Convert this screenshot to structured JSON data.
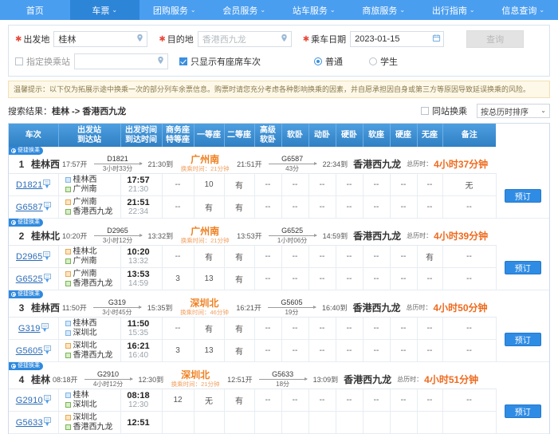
{
  "nav": {
    "items": [
      {
        "label": "首页",
        "caret": false,
        "active": false
      },
      {
        "label": "车票",
        "caret": true,
        "active": true
      },
      {
        "label": "团购服务",
        "caret": true,
        "active": false
      },
      {
        "label": "会员服务",
        "caret": true,
        "active": false
      },
      {
        "label": "站车服务",
        "caret": true,
        "active": false
      },
      {
        "label": "商旅服务",
        "caret": true,
        "active": false
      },
      {
        "label": "出行指南",
        "caret": true,
        "active": false
      },
      {
        "label": "信息查询",
        "caret": true,
        "active": false
      }
    ],
    "caret_glyph": "⌄"
  },
  "form": {
    "origin_label": "出发地",
    "origin_value": "桂林",
    "dest_label": "目的地",
    "dest_placeholder": "香港西九龙",
    "date_label": "乘车日期",
    "date_value": "2023-01-15",
    "search_label": "查询",
    "transfer_station_label": "指定换乘站",
    "transfer_station_value": "",
    "only_available_label": "只显示有座席车次",
    "only_available_checked": true,
    "ticket_type_normal": "普通",
    "ticket_type_student": "学生",
    "ticket_type_selected": "普通",
    "location_icon": "location-pin-icon",
    "calendar_icon": "calendar-icon"
  },
  "notice": {
    "text": "温馨提示：以下仅为拓展示途中换乘一次的部分列车余票信息。购票时请您充分考虑各种影响换乘的因素，并自愿承担因自身或第三方等原因导致延误换乘的风险。"
  },
  "results_bar": {
    "label": "搜索结果：",
    "route": "桂林 -> 香港西九龙",
    "same_station_label": "同站换乘",
    "same_station_checked": false,
    "sort_value": "按总历时排序",
    "sort_caret": "⌄"
  },
  "table": {
    "headers": [
      {
        "l1": "车次",
        "l2": ""
      },
      {
        "l1": "出发站",
        "l2": "到达站"
      },
      {
        "l1": "出发时间",
        "l2": "到达时间"
      },
      {
        "l1": "商务座",
        "l2": "特等座"
      },
      {
        "l1": "一等座",
        "l2": ""
      },
      {
        "l1": "二等座",
        "l2": ""
      },
      {
        "l1": "高级",
        "l2": "软卧"
      },
      {
        "l1": "软卧",
        "l2": ""
      },
      {
        "l1": "动卧",
        "l2": ""
      },
      {
        "l1": "硬卧",
        "l2": ""
      },
      {
        "l1": "软座",
        "l2": ""
      },
      {
        "l1": "硬座",
        "l2": ""
      },
      {
        "l1": "无座",
        "l2": ""
      },
      {
        "l1": "备注",
        "l2": ""
      }
    ],
    "tag_label": "便捷换乘",
    "book_label": "预订",
    "total_label": "总历时：",
    "transfer_time_prefix": "换乘时间："
  },
  "results": [
    {
      "index": "1",
      "from": "桂林西",
      "dep": "17:57开",
      "leg1_train": "D1821",
      "leg1_dur": "3小时33分",
      "leg1_arr": "21:30到",
      "transfer_station": "广州南",
      "transfer_time": "21分钟",
      "leg2_dep": "21:51开",
      "leg2_train": "G6587",
      "leg2_dur": "43分",
      "leg2_arr": "22:34到",
      "to": "香港西九龙",
      "total": "4小时37分钟",
      "legs": [
        {
          "train": "D1821",
          "from": "桂林西",
          "from_color": "blue",
          "to": "广州南",
          "to_color": "green",
          "dep": "17:57",
          "arr": "21:30",
          "cells": [
            "--",
            "10",
            "有",
            "--",
            "--",
            "--",
            "--",
            "--",
            "--",
            "--",
            "无"
          ]
        },
        {
          "train": "G6587",
          "from": "广州南",
          "from_color": "orange",
          "to": "香港西九龙",
          "to_color": "green",
          "dep": "21:51",
          "arr": "22:34",
          "cells": [
            "--",
            "有",
            "有",
            "--",
            "--",
            "--",
            "--",
            "--",
            "--",
            "--",
            "--"
          ]
        }
      ]
    },
    {
      "index": "2",
      "from": "桂林北",
      "dep": "10:20开",
      "leg1_train": "D2965",
      "leg1_dur": "3小时12分",
      "leg1_arr": "13:32到",
      "transfer_station": "广州南",
      "transfer_time": "21分钟",
      "leg2_dep": "13:53开",
      "leg2_train": "G6525",
      "leg2_dur": "1小时06分",
      "leg2_arr": "14:59到",
      "to": "香港西九龙",
      "total": "4小时39分钟",
      "legs": [
        {
          "train": "D2965",
          "from": "桂林北",
          "from_color": "orange",
          "to": "广州南",
          "to_color": "green",
          "dep": "10:20",
          "arr": "13:32",
          "cells": [
            "--",
            "有",
            "有",
            "--",
            "--",
            "--",
            "--",
            "--",
            "--",
            "有",
            "--"
          ]
        },
        {
          "train": "G6525",
          "from": "广州南",
          "from_color": "orange",
          "to": "香港西九龙",
          "to_color": "green",
          "dep": "13:53",
          "arr": "14:59",
          "cells": [
            "3",
            "13",
            "有",
            "--",
            "--",
            "--",
            "--",
            "--",
            "--",
            "--",
            "--"
          ]
        }
      ]
    },
    {
      "index": "3",
      "from": "桂林西",
      "dep": "11:50开",
      "leg1_train": "G319",
      "leg1_dur": "3小时45分",
      "leg1_arr": "15:35到",
      "transfer_station": "深圳北",
      "transfer_time": "46分钟",
      "leg2_dep": "16:21开",
      "leg2_train": "G5605",
      "leg2_dur": "19分",
      "leg2_arr": "16:40到",
      "to": "香港西九龙",
      "total": "4小时50分钟",
      "legs": [
        {
          "train": "G319",
          "from": "桂林西",
          "from_color": "blue",
          "to": "深圳北",
          "to_color": "blue",
          "dep": "11:50",
          "arr": "15:35",
          "cells": [
            "--",
            "有",
            "有",
            "--",
            "--",
            "--",
            "--",
            "--",
            "--",
            "--",
            "--"
          ]
        },
        {
          "train": "G5605",
          "from": "深圳北",
          "from_color": "orange",
          "to": "香港西九龙",
          "to_color": "green",
          "dep": "16:21",
          "arr": "16:40",
          "cells": [
            "3",
            "13",
            "有",
            "--",
            "--",
            "--",
            "--",
            "--",
            "--",
            "--",
            "--"
          ]
        }
      ]
    },
    {
      "index": "4",
      "from": "桂林",
      "dep": "08:18开",
      "leg1_train": "G2910",
      "leg1_dur": "4小时12分",
      "leg1_arr": "12:30到",
      "transfer_station": "深圳北",
      "transfer_time": "21分钟",
      "leg2_dep": "12:51开",
      "leg2_train": "G5633",
      "leg2_dur": "18分",
      "leg2_arr": "13:09到",
      "to": "香港西九龙",
      "total": "4小时51分钟",
      "legs": [
        {
          "train": "G2910",
          "from": "桂林",
          "from_color": "blue",
          "to": "深圳北",
          "to_color": "green",
          "dep": "08:18",
          "arr": "12:30",
          "cells": [
            "12",
            "无",
            "有",
            "--",
            "--",
            "--",
            "--",
            "--",
            "--",
            "--",
            "--"
          ]
        },
        {
          "train": "G5633",
          "from": "深圳北",
          "from_color": "orange",
          "to": "香港西九龙",
          "to_color": "green",
          "dep": "12:51",
          "arr": "",
          "cells": [
            "",
            "",
            "",
            "",
            "",
            "",
            "",
            "",
            "",
            "",
            ""
          ]
        }
      ]
    }
  ],
  "colors": {
    "nav_bg": "#4a9ef0",
    "nav_active": "#2d85d8",
    "accent_orange": "#ef6a1d",
    "available_green": "#36a832",
    "link_blue": "#2b6cb8"
  }
}
